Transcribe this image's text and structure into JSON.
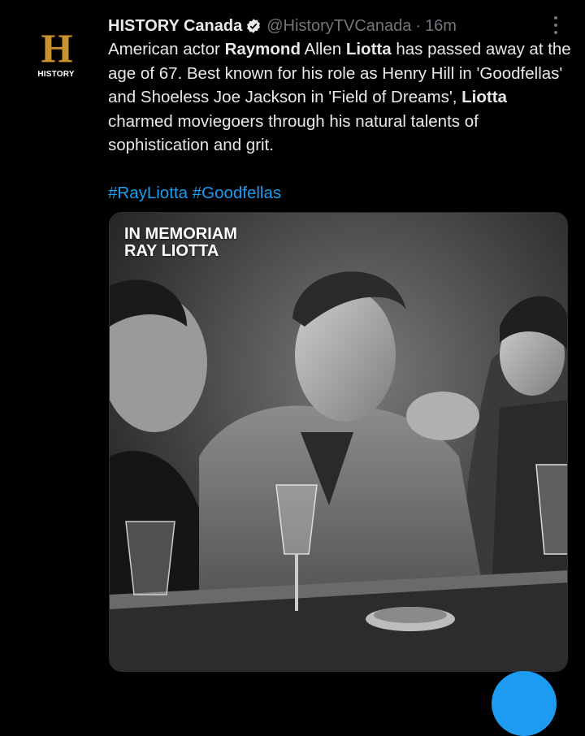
{
  "author": {
    "logo_letter": "H",
    "logo_text": "HISTORY",
    "name": "HISTORY Canada",
    "handle": "@HistoryTVCanada",
    "separator": "·",
    "time": "16m"
  },
  "tweet": {
    "segments": [
      {
        "text": "American actor ",
        "bold": false
      },
      {
        "text": "Raymond",
        "bold": true
      },
      {
        "text": " Allen ",
        "bold": false
      },
      {
        "text": "Liotta",
        "bold": true
      },
      {
        "text": " has passed away at the age of 67. Best known for his role as Henry Hill in 'Goodfellas' and Shoeless Joe Jackson in 'Field of Dreams', ",
        "bold": false
      },
      {
        "text": "Liotta",
        "bold": true
      },
      {
        "text": " charmed moviegoers through his natural talents of sophistication and grit.",
        "bold": false
      }
    ],
    "hashtags": [
      "#RayLiotta",
      "#Goodfellas"
    ]
  },
  "media": {
    "caption_line1": "IN MEMORIAM",
    "caption_line2": "RAY LIOTTA"
  },
  "colors": {
    "background": "#000000",
    "text": "#e7e9ea",
    "muted": "#71767b",
    "link": "#1d9bf0",
    "logo_gold": "#c8922e"
  },
  "icons": [
    "history-logo",
    "verified-badge-icon",
    "more-options-icon"
  ]
}
